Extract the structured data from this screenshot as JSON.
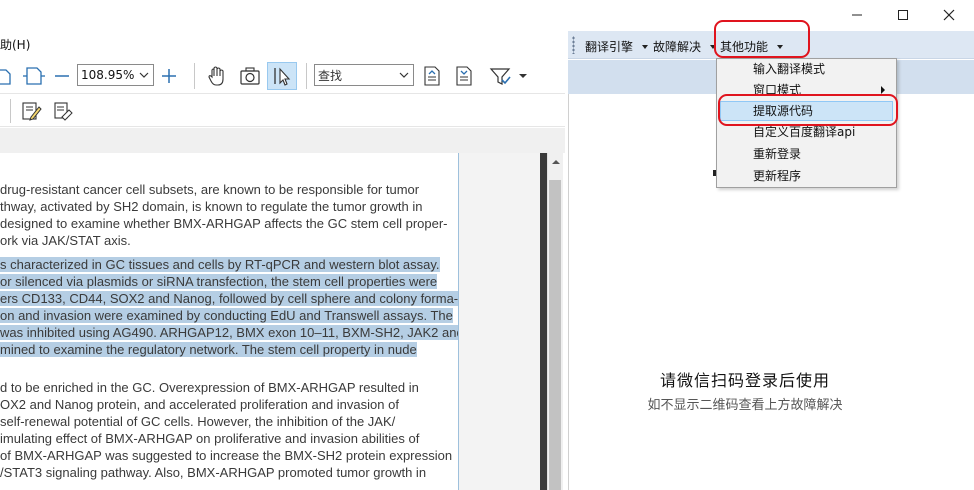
{
  "window": {
    "minimize_icon": "minimize-icon",
    "maximize_icon": "maximize-icon",
    "close_icon": "close-icon"
  },
  "menubar": {
    "help_fragment": "助(H)"
  },
  "toolbar": {
    "zoom_value": "108.95%",
    "search_placeholder": "查找"
  },
  "document": {
    "lines": [
      {
        "text": "drug-resistant cancer cell subsets, are known to be responsible for tumor",
        "highlighted": false
      },
      {
        "text": "thway, activated by SH2 domain, is known to regulate the tumor growth in",
        "highlighted": false
      },
      {
        "text": "designed to examine whether BMX-ARHGAP affects the GC stem cell proper-",
        "highlighted": false
      },
      {
        "text": "ork via JAK/STAT axis.",
        "highlighted": false
      },
      {
        "text": "s characterized in GC tissues and cells by RT-qPCR and western blot assay.",
        "highlighted": true
      },
      {
        "text": " or silenced via plasmids or siRNA transfection, the stem cell properties were",
        "highlighted": true
      },
      {
        "text": "ers CD133, CD44, SOX2 and Nanog, followed by cell sphere and colony forma-",
        "highlighted": true
      },
      {
        "text": "on and invasion were examined by conducting EdU and Transwell assays. The",
        "highlighted": true
      },
      {
        "text": "was inhibited using AG490. ARHGAP12, BMX exon 10–11, BXM-SH2, JAK2 and",
        "highlighted": true
      },
      {
        "text": "mined to examine the regulatory network. The stem cell property in nude",
        "highlighted": true
      },
      {
        "text": "d to be enriched in the GC. Overexpression of BMX-ARHGAP resulted in",
        "highlighted": false
      },
      {
        "text": "OX2 and Nanog protein, and accelerated proliferation and invasion of",
        "highlighted": false
      },
      {
        "text": " self-renewal potential of GC cells. However, the inhibition of the JAK/",
        "highlighted": false
      },
      {
        "text": "imulating effect of BMX-ARHGAP on proliferative and invasion abilities of",
        "highlighted": false
      },
      {
        "text": " of BMX-ARHGAP was suggested to increase the BMX-SH2 protein expression",
        "highlighted": false
      },
      {
        "text": "/STAT3 signaling pathway. Also, BMX-ARHGAP promoted tumor growth in",
        "highlighted": false
      }
    ]
  },
  "translator": {
    "toolbar": {
      "engine_label": "翻译引擎",
      "troubleshoot_label": "故障解决",
      "other_label": "其他功能"
    },
    "menu": {
      "items": [
        {
          "label": "输入翻译模式"
        },
        {
          "label": "窗口模式"
        },
        {
          "label": "提取源代码"
        },
        {
          "label": "自定义百度翻译api"
        },
        {
          "label": "重新登录"
        },
        {
          "label": "更新程序"
        }
      ],
      "selected_index": 2
    },
    "login_message": "请微信扫码登录后使用",
    "login_hint": "如不显示二维码查看上方故障解决"
  },
  "colors": {
    "highlight": "#b5cee4",
    "annotation_red": "#e0141e",
    "panel_toolbar": "#dde7f3"
  }
}
